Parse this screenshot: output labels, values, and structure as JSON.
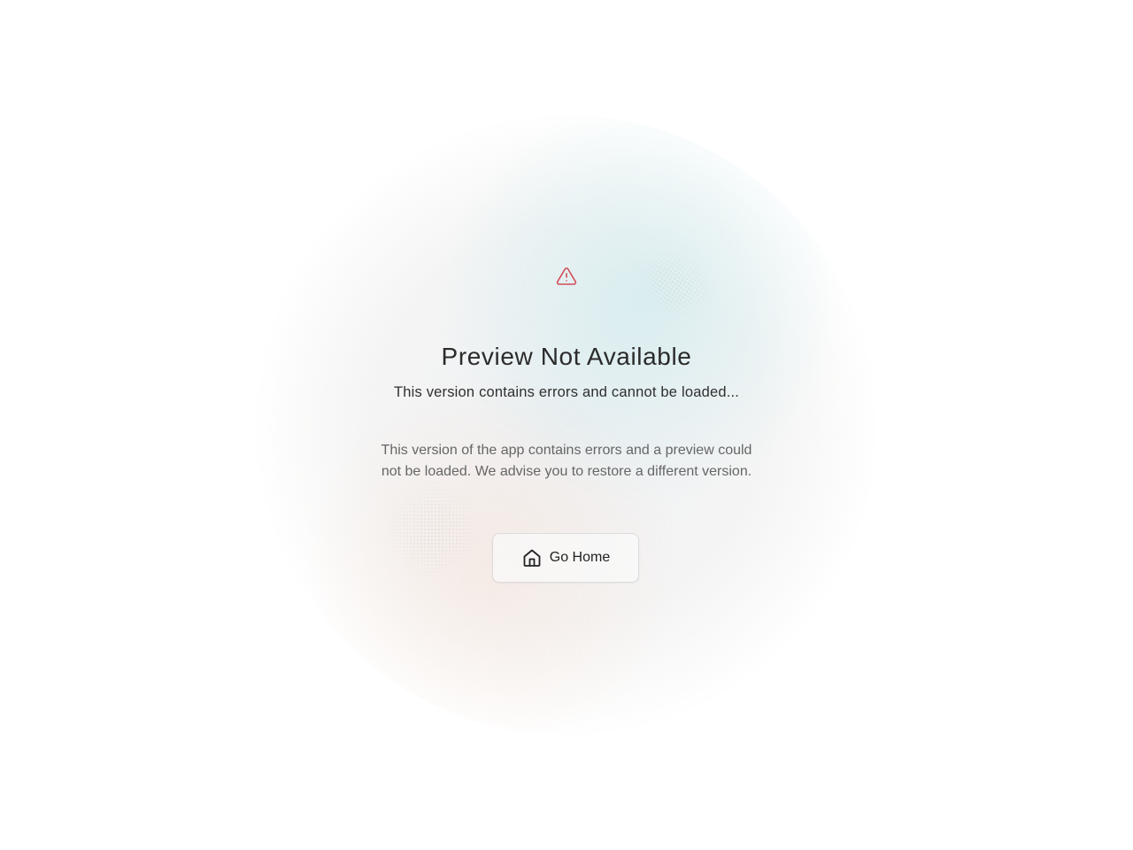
{
  "error_page": {
    "icon": "alert-triangle-icon",
    "title": "Preview Not Available",
    "subtitle": "This version contains errors and cannot be loaded...",
    "description": "This version of the app contains errors and a preview could not be loaded. We advise you to restore a different version.",
    "home_button": {
      "label": "Go Home",
      "icon": "home-icon"
    }
  },
  "colors": {
    "accent_error": "#d14d57",
    "title_text": "#2b2b2b",
    "body_text": "#666666"
  }
}
